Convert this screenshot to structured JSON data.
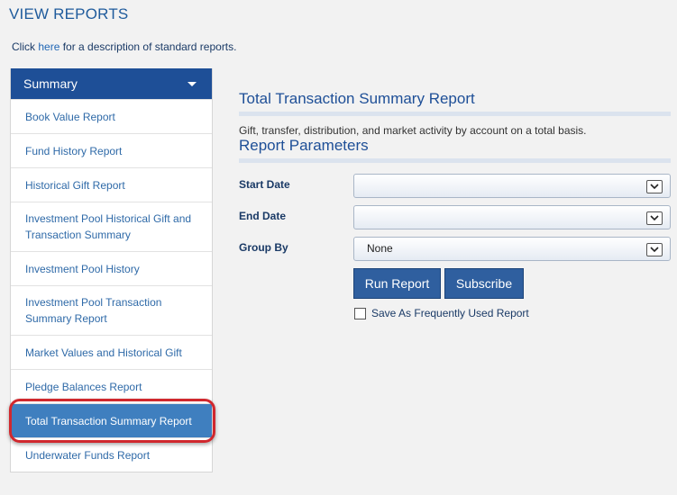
{
  "header": {
    "title": "VIEW REPORTS"
  },
  "intro": {
    "prefix": "Click ",
    "link": "here",
    "suffix": " for a description of standard reports."
  },
  "sidebar": {
    "header_label": "Summary",
    "items": [
      {
        "label": "Book Value Report"
      },
      {
        "label": "Fund History Report"
      },
      {
        "label": "Historical Gift Report"
      },
      {
        "label": "Investment Pool Historical Gift and Transaction Summary"
      },
      {
        "label": "Investment Pool History"
      },
      {
        "label": "Investment Pool Transaction Summary Report"
      },
      {
        "label": "Market Values and Historical Gift"
      },
      {
        "label": "Pledge Balances Report"
      },
      {
        "label": "Total Transaction Summary Report"
      },
      {
        "label": "Underwater Funds Report"
      }
    ]
  },
  "report": {
    "title": "Total Transaction Summary Report",
    "description": "Gift, transfer, distribution, and market activity by account on a total basis.",
    "params_title": "Report Parameters",
    "start_date_label": "Start Date",
    "start_date_value": "",
    "end_date_label": "End Date",
    "end_date_value": "",
    "group_by_label": "Group By",
    "group_by_value": "None",
    "run_label": "Run Report",
    "subscribe_label": "Subscribe",
    "save_label": "Save As Frequently Used Report"
  },
  "colors": {
    "accent": "#1e4f97",
    "active": "#3f7fbf",
    "highlight": "#d0282e"
  }
}
